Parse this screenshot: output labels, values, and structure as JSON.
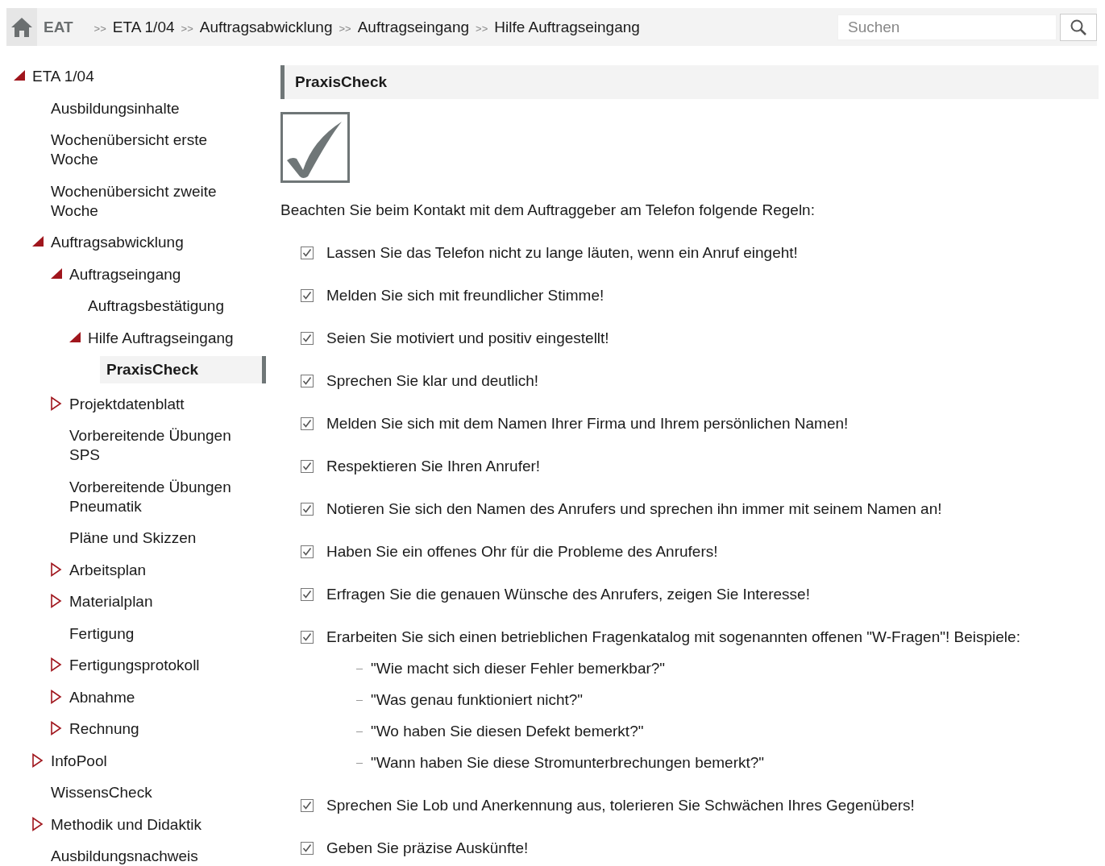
{
  "breadcrumb": {
    "home": "EAT",
    "separator": ">>",
    "items": [
      "ETA 1/04",
      "Auftragsabwicklung",
      "Auftragseingang",
      "Hilfe Auftragseingang"
    ]
  },
  "search": {
    "placeholder": "Suchen"
  },
  "sidebar": {
    "items": [
      {
        "label": "ETA 1/04",
        "expanded": true,
        "selected": false,
        "children": [
          {
            "label": "Ausbildungsinhalte",
            "selected": false
          },
          {
            "label": "Wochenübersicht erste Woche",
            "selected": false
          },
          {
            "label": "Wochenübersicht zweite Woche",
            "selected": false
          },
          {
            "label": "Auftragsabwicklung",
            "expanded": true,
            "selected": false,
            "children": [
              {
                "label": "Auftragseingang",
                "expanded": true,
                "selected": false,
                "children": [
                  {
                    "label": "Auftragsbestätigung",
                    "selected": false
                  },
                  {
                    "label": "Hilfe Auftragseingang",
                    "expanded": true,
                    "selected": false,
                    "children": [
                      {
                        "label": "PraxisCheck",
                        "selected": true
                      }
                    ]
                  }
                ]
              },
              {
                "label": "Projektdatenblatt",
                "expanded": false,
                "selected": false
              },
              {
                "label": "Vorbereitende Übungen SPS",
                "selected": false
              },
              {
                "label": "Vorbereitende Übungen Pneumatik",
                "selected": false
              },
              {
                "label": "Pläne und Skizzen",
                "selected": false
              },
              {
                "label": "Arbeitsplan",
                "expanded": false,
                "selected": false
              },
              {
                "label": "Materialplan",
                "expanded": false,
                "selected": false
              },
              {
                "label": "Fertigung",
                "selected": false
              },
              {
                "label": "Fertigungsprotokoll",
                "expanded": false,
                "selected": false
              },
              {
                "label": "Abnahme",
                "expanded": false,
                "selected": false
              },
              {
                "label": "Rechnung",
                "expanded": false,
                "selected": false
              }
            ]
          },
          {
            "label": "InfoPool",
            "expanded": false,
            "selected": false
          },
          {
            "label": "WissensCheck",
            "selected": false
          },
          {
            "label": "Methodik und Didaktik",
            "expanded": false,
            "selected": false
          },
          {
            "label": "Ausbildungsnachweis",
            "selected": false
          }
        ]
      }
    ]
  },
  "content": {
    "title": "PraxisCheck",
    "intro": "Beachten Sie beim Kontakt mit dem Auftraggeber am Telefon folgende Regeln:",
    "rules": [
      {
        "text": "Lassen Sie das Telefon nicht zu lange läuten, wenn ein Anruf eingeht!",
        "checked": true
      },
      {
        "text": "Melden Sie sich mit freundlicher Stimme!",
        "checked": true
      },
      {
        "text": "Seien Sie motiviert und positiv eingestellt!",
        "checked": true
      },
      {
        "text": "Sprechen Sie klar und deutlich!",
        "checked": true
      },
      {
        "text": "Melden Sie sich mit dem Namen Ihrer Firma und Ihrem persönlichen Namen!",
        "checked": true
      },
      {
        "text": "Respektieren Sie Ihren Anrufer!",
        "checked": true
      },
      {
        "text": "Notieren Sie sich den Namen des Anrufers und sprechen ihn immer mit seinem Namen an!",
        "checked": true
      },
      {
        "text": "Haben Sie ein offenes Ohr für die Probleme des Anrufers!",
        "checked": true
      },
      {
        "text": "Erfragen Sie die genauen Wünsche des Anrufers, zeigen Sie Interesse!",
        "checked": true
      },
      {
        "text": "Erarbeiten Sie sich einen betrieblichen Fragenkatalog mit sogenannten offenen \"W-Fragen\"! Beispiele:",
        "checked": true,
        "examples": [
          "\"Wie macht sich dieser Fehler bemerkbar?\"",
          "\"Was genau funktioniert nicht?\"",
          "\"Wo haben Sie diesen Defekt bemerkt?\"",
          "\"Wann haben Sie diese Stromunterbrechungen bemerkt?\""
        ]
      },
      {
        "text": "Sprechen Sie Lob und Anerkennung aus, tolerieren Sie Schwächen Ihres Gegenübers!",
        "checked": true
      },
      {
        "text": "Geben Sie präzise Auskünfte!",
        "checked": true
      }
    ]
  }
}
